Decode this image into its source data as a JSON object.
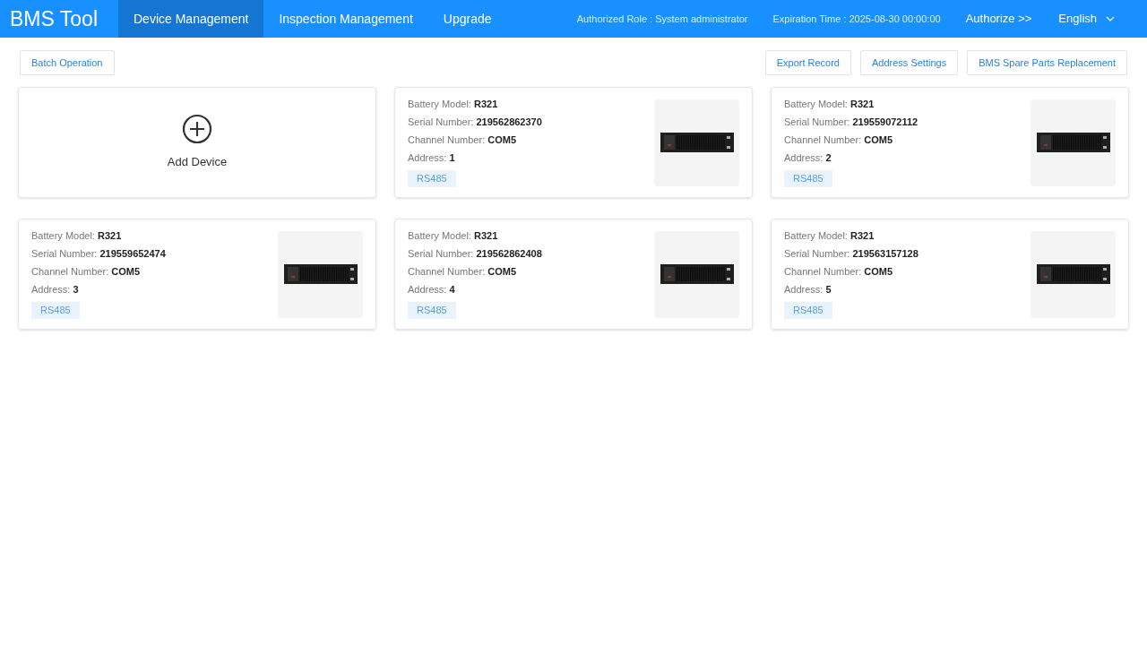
{
  "header": {
    "logo": "BMS Tool",
    "nav": [
      {
        "label": "Device Management",
        "selected": true
      },
      {
        "label": "Inspection Management",
        "selected": false
      },
      {
        "label": "Upgrade",
        "selected": false
      }
    ],
    "role": "Authorized Role : System administrator",
    "expiration": "Expiration Time : 2025-08-30 00:00:00",
    "authorize": "Authorize >>",
    "language": "English"
  },
  "toolbar": {
    "left": [
      "Batch Operation"
    ],
    "right": [
      "Export Record",
      "Address Settings",
      "BMS Spare Parts Replacement"
    ]
  },
  "add_card": {
    "label": "Add Device"
  },
  "devices": [
    {
      "lines": [
        "Battery Model: **R321**",
        "Serial Number: **219562862370**",
        "Channel Number: **COM5**",
        "Address: **1**"
      ],
      "tag": "RS485"
    },
    {
      "lines": [
        "Battery Model: **R321**",
        "Serial Number: **219559072112**",
        "Channel Number: **COM5**",
        "Address: **2**"
      ],
      "tag": "RS485"
    },
    {
      "lines": [
        "Battery Model: **R321**",
        "Serial Number: **219559652474**",
        "Channel Number: **COM5**",
        "Address: **3**"
      ],
      "tag": "RS485"
    },
    {
      "lines": [
        "Battery Model: **R321**",
        "Serial Number: **219562862408**",
        "Channel Number: **COM5**",
        "Address: **4**"
      ],
      "tag": "RS485"
    },
    {
      "lines": [
        "Battery Model: **R321**",
        "Serial Number: **219563157128**",
        "Channel Number: **COM5**",
        "Address: **5**"
      ],
      "tag": "RS485"
    }
  ]
}
